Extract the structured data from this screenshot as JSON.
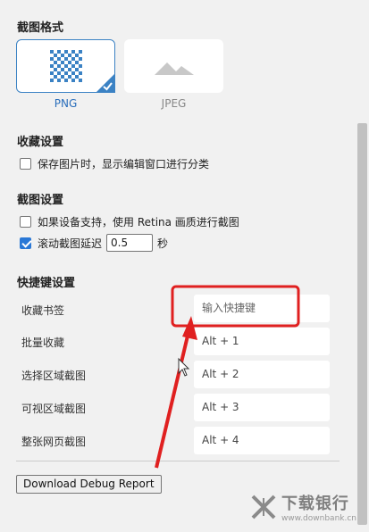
{
  "format": {
    "title": "截图格式",
    "options": [
      {
        "label": "PNG",
        "selected": true
      },
      {
        "label": "JPEG",
        "selected": false
      }
    ],
    "colors": {
      "accent": "#3b82c4",
      "label_selected": "#2a6ebb",
      "label_unselected": "#888888"
    }
  },
  "bookmark": {
    "title": "收藏设置",
    "options": [
      {
        "label": "保存图片时，显示编辑窗口进行分类",
        "checked": false
      }
    ]
  },
  "capture": {
    "title": "截图设置",
    "options": [
      {
        "label": "如果设备支持，使用 Retina 画质进行截图",
        "checked": false
      },
      {
        "label": "滚动截图延迟",
        "checked": true
      }
    ],
    "delay_value": "0.5",
    "delay_unit": "秒"
  },
  "shortcuts": {
    "title": "快捷键设置",
    "items": [
      {
        "label": "收藏书签",
        "value": "",
        "placeholder": "输入快捷键"
      },
      {
        "label": "批量收藏",
        "value": "Alt + 1"
      },
      {
        "label": "选择区域截图",
        "value": "Alt + 2"
      },
      {
        "label": "可视区域截图",
        "value": "Alt + 3"
      },
      {
        "label": "整张网页截图",
        "value": "Alt + 4"
      }
    ]
  },
  "debug_button": "Download Debug Report",
  "watermark": {
    "title": "下载银行",
    "subtitle": "www.downbank.cn"
  },
  "annotation_color": "#e02020"
}
